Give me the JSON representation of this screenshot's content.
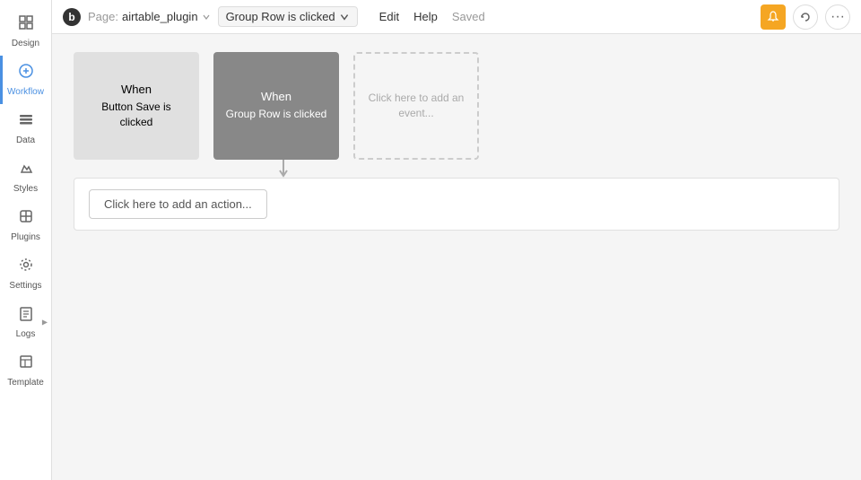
{
  "topbar": {
    "logo": "b",
    "page_label": "Page:",
    "page_name": "airtable_plugin",
    "dropdown_label": "Group Row is clicked",
    "nav": [
      "Edit",
      "Help"
    ],
    "status": "Saved",
    "icon_btn_symbol": "🔔",
    "undo_symbol": "↩"
  },
  "sidebar": {
    "items": [
      {
        "id": "design",
        "label": "Design",
        "icon": "✦",
        "active": false
      },
      {
        "id": "workflow",
        "label": "Workflow",
        "icon": "⬡",
        "active": true
      },
      {
        "id": "data",
        "label": "Data",
        "icon": "⊞",
        "active": false
      },
      {
        "id": "styles",
        "label": "Styles",
        "icon": "✎",
        "active": false
      },
      {
        "id": "plugins",
        "label": "Plugins",
        "icon": "⬡",
        "active": false
      },
      {
        "id": "settings",
        "label": "Settings",
        "icon": "⚙",
        "active": false
      },
      {
        "id": "logs",
        "label": "Logs",
        "icon": "☰",
        "active": false,
        "has_arrow": true
      },
      {
        "id": "template",
        "label": "Template",
        "icon": "☐",
        "active": false
      }
    ]
  },
  "workflow": {
    "events": [
      {
        "id": "btn-save",
        "when_label": "When",
        "desc": "Button Save is clicked",
        "style": "light"
      },
      {
        "id": "group-row",
        "when_label": "When",
        "desc": "Group Row is clicked",
        "style": "dark"
      },
      {
        "id": "add-event",
        "when_label": "",
        "desc": "Click here to add an event...",
        "style": "dashed"
      }
    ],
    "add_action_label": "Click here to add an action..."
  }
}
